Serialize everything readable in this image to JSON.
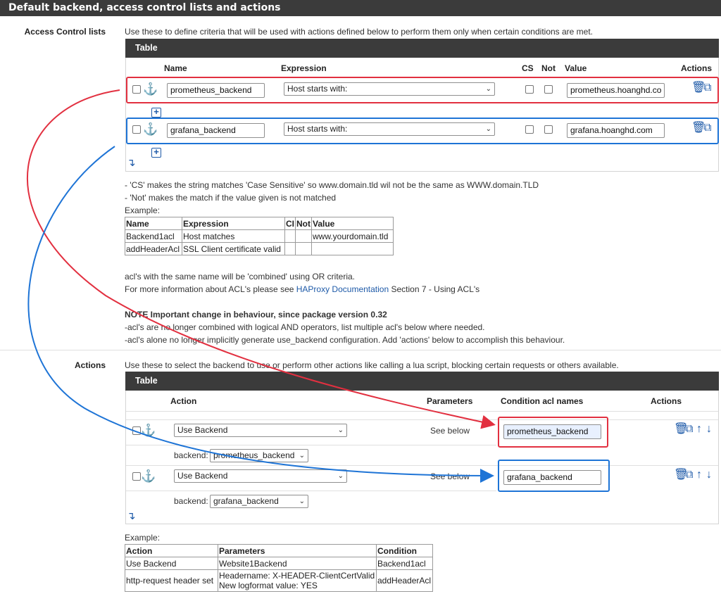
{
  "panel_title": "Default backend, access control lists and actions",
  "acl": {
    "label": "Access Control lists",
    "description": "Use these to define criteria that will be used with actions defined below to perform them only when certain conditions are met.",
    "table_title": "Table",
    "columns": {
      "name": "Name",
      "expression": "Expression",
      "cs": "CS",
      "not": "Not",
      "value": "Value",
      "actions": "Actions"
    },
    "rows": [
      {
        "name": "prometheus_backend",
        "expression": "Host starts with:",
        "value": "prometheus.hoanghd.co"
      },
      {
        "name": "grafana_backend",
        "expression": "Host starts with:",
        "value": "grafana.hoanghd.com"
      }
    ],
    "help_cs": "- 'CS' makes the string matches 'Case Sensitive' so www.domain.tld wil not be the same as WWW.domain.TLD",
    "help_not": "- 'Not' makes the match if the value given is not matched",
    "example_label": "Example:",
    "example_table": {
      "headers": [
        "Name",
        "Expression",
        "CI",
        "Not",
        "Value"
      ],
      "rows": [
        [
          "Backend1acl",
          "Host matches",
          "",
          "",
          "www.yourdomain.tld"
        ],
        [
          "addHeaderAcl",
          "SSL Client certificate valid",
          "",
          "",
          ""
        ]
      ]
    },
    "combined_note": "acl's with the same name will be 'combined' using OR criteria.",
    "more_info_prefix": "For more information about ACL's please see ",
    "more_info_link": "HAProxy Documentation",
    "more_info_suffix": " Section 7 - Using ACL's",
    "note_title": "NOTE Important change in behaviour, since package version 0.32",
    "note_line1": "-acl's are no longer combined with logical AND operators, list multiple acl's below where needed.",
    "note_line2": "-acl's alone no longer implicitly generate use_backend configuration. Add 'actions' below to accomplish this behaviour."
  },
  "actions": {
    "label": "Actions",
    "description": "Use these to select the backend to use or perform other actions like calling a lua script, blocking certain requests or others available.",
    "table_title": "Table",
    "columns": {
      "action": "Action",
      "parameters": "Parameters",
      "condition": "Condition acl names",
      "actions": "Actions"
    },
    "rows": [
      {
        "action": "Use Backend",
        "parameters": "See below",
        "condition": "prometheus_backend",
        "backend_label": "backend:",
        "backend_value": "prometheus_backend"
      },
      {
        "action": "Use Backend",
        "parameters": "See below",
        "condition": "grafana_backend",
        "backend_label": "backend:",
        "backend_value": "grafana_backend"
      }
    ],
    "example_label": "Example:",
    "example_table": {
      "headers": [
        "Action",
        "Parameters",
        "Condition"
      ],
      "rows": [
        [
          "Use Backend",
          "Website1Backend",
          "Backend1acl"
        ],
        [
          "http-request header set",
          "Headername: X-HEADER-ClientCertValid",
          "addHeaderAcl"
        ]
      ],
      "extra_param_line": "New logformat value: YES"
    }
  },
  "colors": {
    "red": "#e23040",
    "blue": "#1e74d6",
    "header": "#3b3b3b",
    "icon": "#1e5aa8"
  }
}
